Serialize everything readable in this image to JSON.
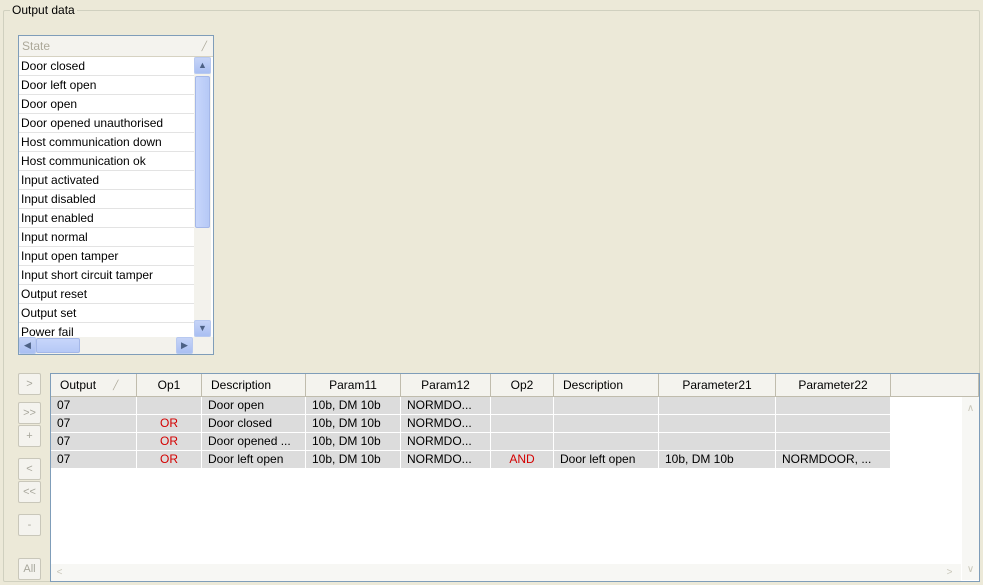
{
  "group": {
    "title": "Output data"
  },
  "state_list": {
    "header": "State",
    "items": [
      "Door closed",
      "Door left open",
      "Door open",
      "Door opened unauthorised",
      "Host communication down",
      "Host communication ok",
      "Input activated",
      "Input disabled",
      "Input enabled",
      "Input normal",
      "Input open tamper",
      "Input short circuit tamper",
      "Output reset",
      "Output set",
      "Power fail"
    ]
  },
  "side_buttons": [
    ">",
    ">>",
    "+",
    "<",
    "<<",
    "-",
    "All"
  ],
  "grid": {
    "columns": [
      "Output",
      "Op1",
      "Description",
      "Param11",
      "Param12",
      "Op2",
      "Description",
      "Parameter21",
      "Parameter22"
    ],
    "rows": [
      [
        "07",
        "",
        "Door open",
        "10b, DM 10b",
        "NORMDO...",
        "",
        "",
        "",
        ""
      ],
      [
        "07",
        "OR",
        "Door closed",
        "10b, DM 10b",
        "NORMDO...",
        "",
        "",
        "",
        ""
      ],
      [
        "07",
        "OR",
        "Door opened ...",
        "10b, DM 10b",
        "NORMDO...",
        "",
        "",
        "",
        ""
      ],
      [
        "07",
        "OR",
        "Door left open",
        "10b, DM 10b",
        "NORMDO...",
        "AND",
        "Door left open",
        "10b, DM 10b",
        "NORMDOOR, ..."
      ]
    ]
  },
  "colors": {
    "operator": "#d40000",
    "row_bg": "#dcdcdc",
    "window_bg": "#ece9d8"
  }
}
